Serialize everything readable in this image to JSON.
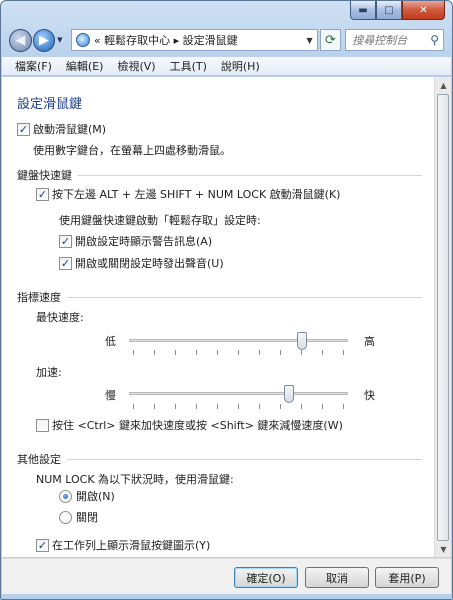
{
  "window": {
    "caption_buttons": {
      "minimize": "▬",
      "maximize": "□",
      "close": "✕"
    }
  },
  "navbar": {
    "back_icon": "back-arrow",
    "forward_icon": "forward-arrow",
    "address_prefix": "«",
    "address_path": "輕鬆存取中心",
    "address_sep": "▸",
    "address_current": "設定滑鼠鍵",
    "search_placeholder": "搜尋控制台"
  },
  "menubar": [
    "檔案(F)",
    "編輯(E)",
    "檢視(V)",
    "工具(T)",
    "說明(H)"
  ],
  "page": {
    "title": "設定滑鼠鍵",
    "enable": {
      "label": "啟動滑鼠鍵(M)",
      "checked": true
    },
    "enable_desc": "使用數字鍵台，在螢幕上四處移動滑鼠。",
    "shortcut_section": "鍵盤快速鍵",
    "shortcut_toggle": {
      "label": "按下左邊 ALT + 左邊 SHIFT + NUM LOCK 啟動滑鼠鍵(K)",
      "checked": true
    },
    "shortcut_sub_desc": "使用鍵盤快速鍵啟動「輕鬆存取」設定時:",
    "warning_msg": {
      "label": "開啟設定時顯示警告訊息(A)",
      "checked": true
    },
    "sound": {
      "label": "開啟或關閉設定時發出聲音(U)",
      "checked": true
    },
    "pointer_section": "指標速度",
    "top_speed_label": "最快速度:",
    "top_speed_low": "低",
    "top_speed_high": "高",
    "top_speed_value": 0.8,
    "accel_label": "加速:",
    "accel_low": "慢",
    "accel_high": "快",
    "accel_value": 0.74,
    "ctrl_shift": {
      "label": "按住 <Ctrl> 鍵來加快速度或按 <Shift> 鍵來減慢速度(W)",
      "checked": false
    },
    "other_section": "其他設定",
    "numlock_desc": "NUM LOCK 為以下狀況時，使用滑鼠鍵:",
    "numlock_on": {
      "label": "開啟(N)",
      "selected": true
    },
    "numlock_off": {
      "label": "關閉",
      "selected": false
    },
    "taskbar_icon": {
      "label": "在工作列上顯示滑鼠按鍵圖示(Y)",
      "checked": true
    }
  },
  "buttons": {
    "ok": "確定(O)",
    "cancel": "取消",
    "apply": "套用(P)"
  }
}
